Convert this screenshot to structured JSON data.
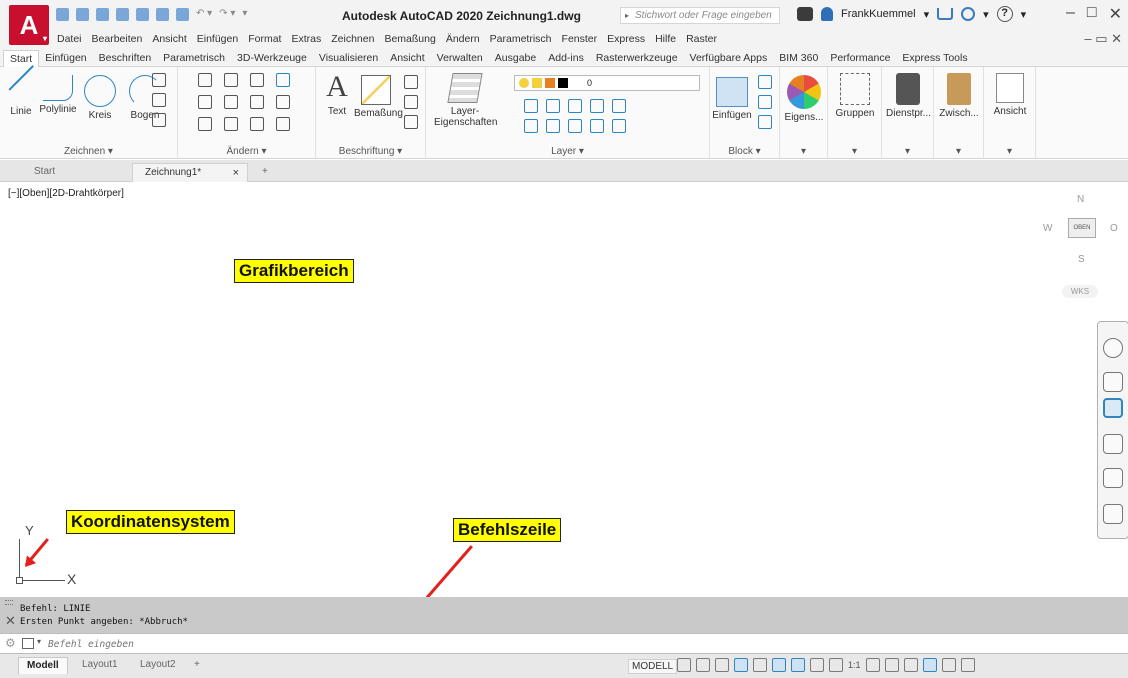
{
  "titlebar": {
    "app_button_letter": "A",
    "title": "Autodesk AutoCAD 2020   Zeichnung1.dwg",
    "search_placeholder": "Stichwort oder Frage eingeben",
    "username": "FrankKuemmel",
    "help_symbol": "?"
  },
  "menubar": {
    "items": [
      "Datei",
      "Bearbeiten",
      "Ansicht",
      "Einfügen",
      "Format",
      "Extras",
      "Zeichnen",
      "Bemaßung",
      "Ändern",
      "Parametrisch",
      "Fenster",
      "Express",
      "Hilfe",
      "Raster"
    ]
  },
  "ribbon_tabs": [
    "Start",
    "Einfügen",
    "Beschriften",
    "Parametrisch",
    "3D-Werkzeuge",
    "Visualisieren",
    "Ansicht",
    "Verwalten",
    "Ausgabe",
    "Add-ins",
    "Rasterwerkzeuge",
    "Verfügbare Apps",
    "BIM 360",
    "Performance",
    "Express Tools"
  ],
  "ribbon": {
    "zeichnen": {
      "title": "Zeichnen",
      "tools": [
        "Linie",
        "Polylinie",
        "Kreis",
        "Bogen"
      ]
    },
    "aendern": {
      "title": "Ändern"
    },
    "beschriftung": {
      "title": "Beschriftung",
      "tools": [
        "Text",
        "Bemaßung"
      ]
    },
    "layer": {
      "title": "Layer",
      "tool_line1": "Layer-",
      "tool_line2": "Eigenschaften",
      "current_layer": "0"
    },
    "block": {
      "title": "Block",
      "tool": "Einfügen"
    },
    "extra_tools": [
      "Eigens...",
      "Gruppen",
      "Dienstpr...",
      "Zwisch...",
      "Ansicht"
    ]
  },
  "file_tabs": {
    "start": "Start",
    "drawing": "Zeichnung1*",
    "close": "×",
    "new": "+"
  },
  "canvas": {
    "viewport_label": "[−][Oben][2D-Drahtkörper]",
    "viewcube": {
      "north": "N",
      "south": "S",
      "east": "O",
      "west": "W",
      "face": "OBEN",
      "wcs": "WKS"
    },
    "ucs": {
      "x": "X",
      "y": "Y"
    }
  },
  "annotations": {
    "graphics": "Grafikbereich",
    "ucs": "Koordinatensystem",
    "command": "Befehlszeile"
  },
  "command": {
    "history": [
      "Befehl: LINIE",
      "Ersten Punkt angeben: *Abbruch*"
    ],
    "input_placeholder": "Befehl eingeben"
  },
  "statusbar": {
    "layout_tabs": [
      "Modell",
      "Layout1",
      "Layout2"
    ],
    "add_layout": "+",
    "model_label": "MODELL",
    "scale": "1:1"
  },
  "colors": {
    "accent": "#2e86c1",
    "annotation_bg": "#ffff00",
    "arrow": "#e3201b",
    "brand": "#c8102e"
  }
}
